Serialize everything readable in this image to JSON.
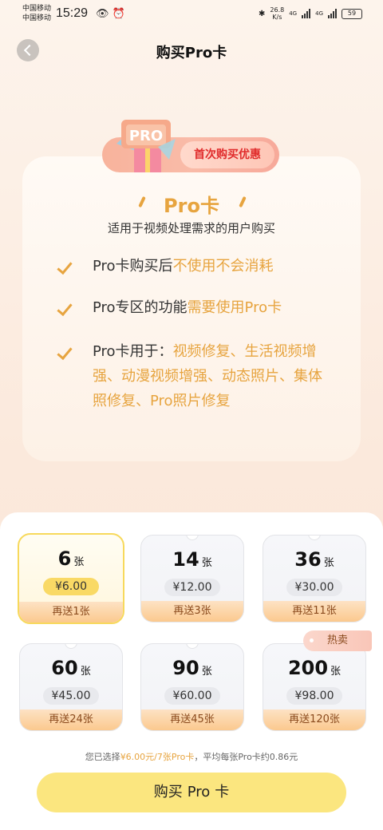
{
  "status_bar": {
    "carrier1": "中国移动",
    "carrier2": "中国移动",
    "time": "15:29",
    "speed_value": "26.8",
    "speed_unit": "K/s",
    "net1": "4G",
    "net2": "4G",
    "battery": "59"
  },
  "header": {
    "title": "购买Pro卡"
  },
  "promo": {
    "badge": "首次购买优惠",
    "gift_label": "PRO"
  },
  "info": {
    "title": "Pro卡",
    "subtitle": "适用于视频处理需求的用户购买",
    "features": [
      {
        "prefix": "Pro卡购买后",
        "highlight": "不使用不会消耗"
      },
      {
        "prefix": "Pro专区的功能",
        "highlight": "需要使用Pro卡"
      },
      {
        "prefix": "Pro卡用于：",
        "highlight": "视频修复、生活视频增强、动漫视频增强、动态照片、集体照修复、Pro照片修复"
      }
    ]
  },
  "packages": [
    {
      "count": "6",
      "unit": "张",
      "price": "¥6.00",
      "bonus": "再送1张",
      "selected": true
    },
    {
      "count": "14",
      "unit": "张",
      "price": "¥12.00",
      "bonus": "再送3张",
      "selected": false
    },
    {
      "count": "36",
      "unit": "张",
      "price": "¥30.00",
      "bonus": "再送11张",
      "selected": false
    },
    {
      "count": "60",
      "unit": "张",
      "price": "¥45.00",
      "bonus": "再送24张",
      "selected": false
    },
    {
      "count": "90",
      "unit": "张",
      "price": "¥60.00",
      "bonus": "再送45张",
      "selected": false
    },
    {
      "count": "200",
      "unit": "张",
      "price": "¥98.00",
      "bonus": "再送120张",
      "selected": false
    }
  ],
  "hot_tag": "热卖",
  "summary": {
    "prefix": "您已选择",
    "selection": "¥6.00元/7张Pro卡",
    "suffix": "，平均每张Pro卡约0.86元"
  },
  "buy_button": {
    "part1": "购买",
    "part2": "Pro",
    "part3": "卡"
  },
  "colors": {
    "accent": "#e7a43f",
    "button": "#fbe67f",
    "selected_price": "#f9d965",
    "promo_red": "#e02b2b"
  }
}
